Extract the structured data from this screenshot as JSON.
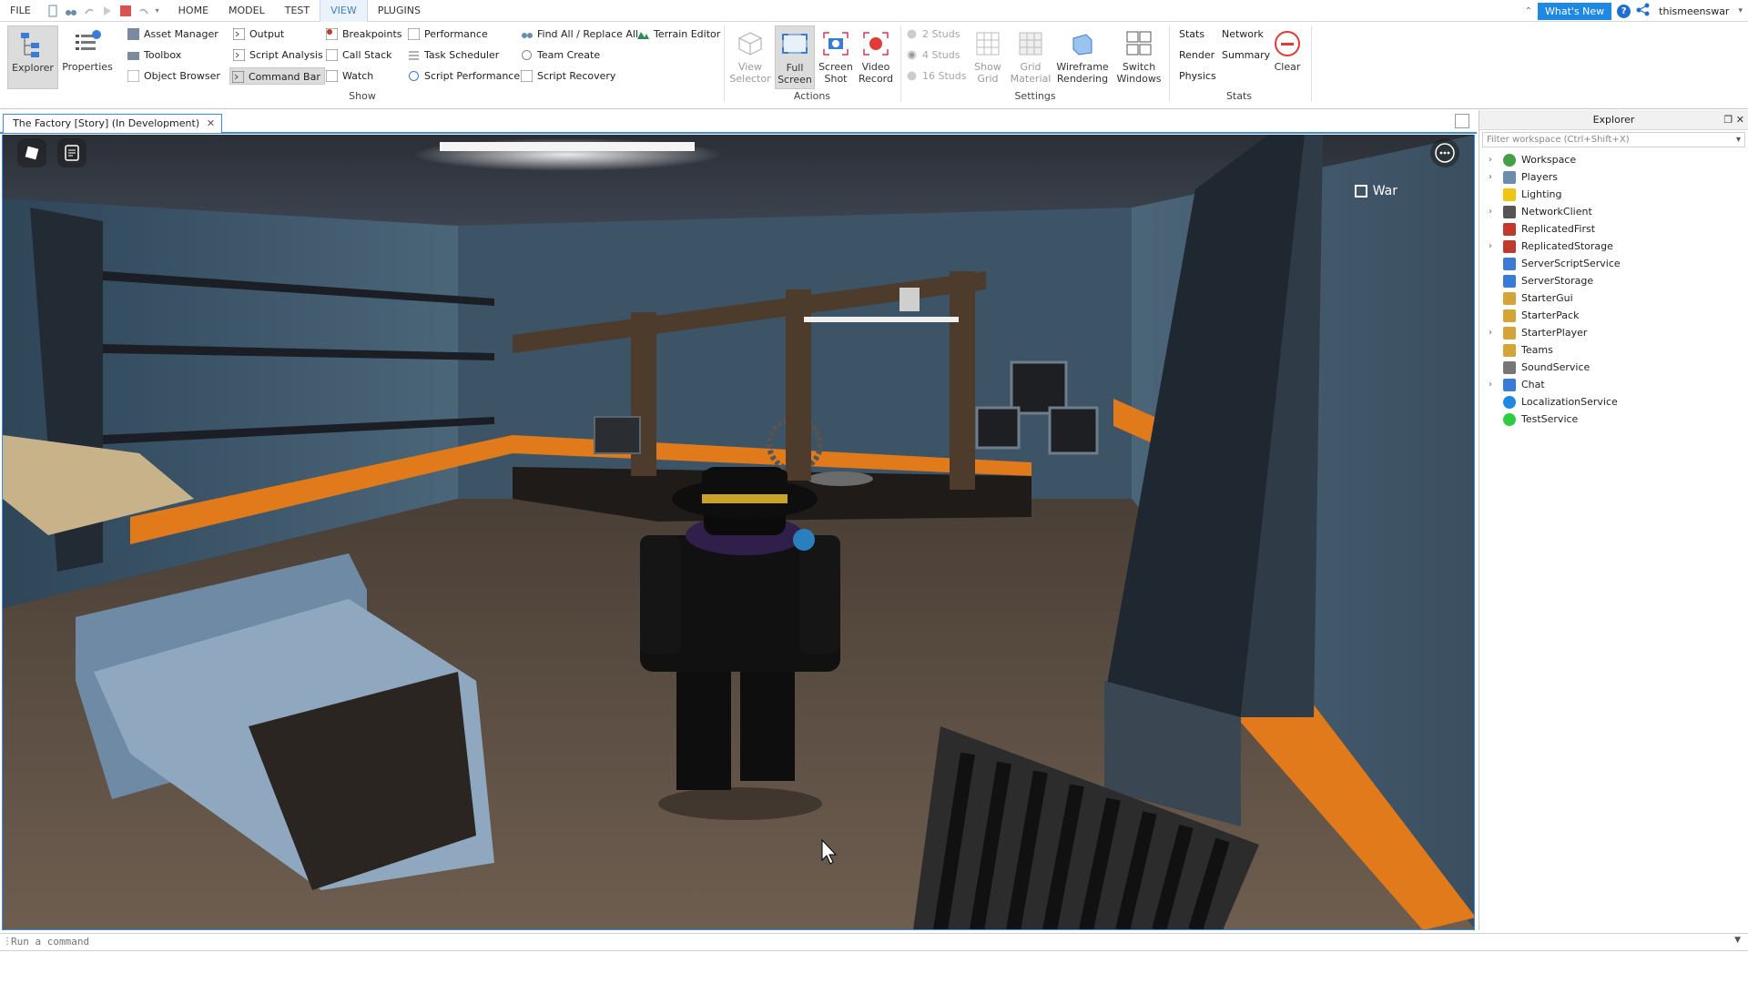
{
  "menubar": {
    "items": [
      "FILE",
      "HOME",
      "MODEL",
      "TEST",
      "VIEW",
      "PLUGINS"
    ],
    "active": "VIEW",
    "whats_new": "What's New",
    "help": "?",
    "username": "thismeenswar"
  },
  "ribbon": {
    "explorer": "Explorer",
    "properties": "Properties",
    "show_items": [
      "Asset Manager",
      "Toolbox",
      "Object Browser",
      "Output",
      "Script Analysis",
      "Command Bar",
      "Breakpoints",
      "Call Stack",
      "Watch",
      "Performance",
      "Task Scheduler",
      "Script Performance",
      "Find All / Replace All",
      "Team Create",
      "Script Recovery",
      "Terrain Editor"
    ],
    "show_label": "Show",
    "actions": {
      "view_selector_1": "View",
      "view_selector_2": "Selector",
      "full_screen_1": "Full",
      "full_screen_2": "Screen",
      "screen_shot_1": "Screen",
      "screen_shot_2": "Shot",
      "video_record_1": "Video",
      "video_record_2": "Record",
      "label": "Actions"
    },
    "settings": {
      "studs": [
        "2 Studs",
        "4 Studs",
        "16 Studs"
      ],
      "show_grid_1": "Show",
      "show_grid_2": "Grid",
      "grid_material_1": "Grid",
      "grid_material_2": "Material",
      "wireframe_1": "Wireframe",
      "wireframe_2": "Rendering",
      "switch_1": "Switch",
      "switch_2": "Windows",
      "label": "Settings"
    },
    "stats": {
      "items": [
        "Stats",
        "Network",
        "Render",
        "Summary",
        "Physics"
      ],
      "clear": "Clear",
      "label": "Stats"
    }
  },
  "tab": {
    "title": "The Factory [Story] (In Development)",
    "close": "✕"
  },
  "viewport": {
    "label": "War"
  },
  "explorer": {
    "title": "Explorer",
    "filter_placeholder": "Filter workspace (Ctrl+Shift+X)",
    "items": [
      {
        "label": "Workspace",
        "expandable": true,
        "icon": "workspace-icon"
      },
      {
        "label": "Players",
        "expandable": true,
        "icon": "players-icon"
      },
      {
        "label": "Lighting",
        "expandable": false,
        "icon": "lighting-icon"
      },
      {
        "label": "NetworkClient",
        "expandable": true,
        "icon": "networkclient-icon"
      },
      {
        "label": "ReplicatedFirst",
        "expandable": false,
        "icon": "replicatedfirst-icon"
      },
      {
        "label": "ReplicatedStorage",
        "expandable": true,
        "icon": "replicatedstorage-icon"
      },
      {
        "label": "ServerScriptService",
        "expandable": false,
        "icon": "serverscriptservice-icon"
      },
      {
        "label": "ServerStorage",
        "expandable": false,
        "icon": "serverstorage-icon"
      },
      {
        "label": "StarterGui",
        "expandable": false,
        "icon": "startergui-icon"
      },
      {
        "label": "StarterPack",
        "expandable": false,
        "icon": "starterpack-icon"
      },
      {
        "label": "StarterPlayer",
        "expandable": true,
        "icon": "starterplayer-icon"
      },
      {
        "label": "Teams",
        "expandable": false,
        "icon": "teams-icon"
      },
      {
        "label": "SoundService",
        "expandable": false,
        "icon": "soundservice-icon"
      },
      {
        "label": "Chat",
        "expandable": true,
        "icon": "chat-icon"
      },
      {
        "label": "LocalizationService",
        "expandable": false,
        "icon": "localizationservice-icon"
      },
      {
        "label": "TestService",
        "expandable": false,
        "icon": "testservice-icon"
      }
    ]
  },
  "command_bar": {
    "placeholder": "Run a command"
  },
  "colors": {
    "accent": "#3b8fde",
    "whats_new": "#1e88e5",
    "record_red": "#e53935",
    "floor_orange": "#e07a1b"
  }
}
